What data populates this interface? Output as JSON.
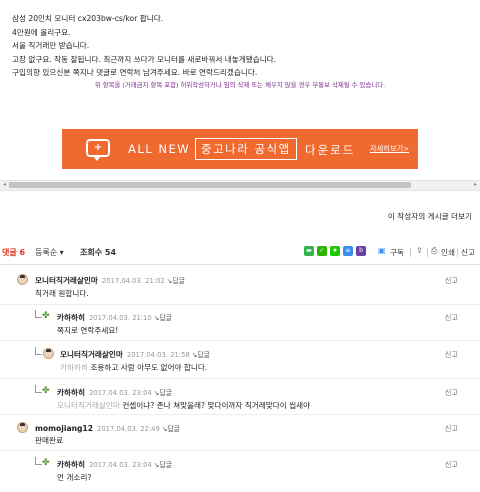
{
  "post": {
    "lines": [
      "삼성 20인치 모니터 cx203bw-cs/kor 팝니다.",
      "4만원에 올리구요.",
      "서울 직거래만 받습니다.",
      "고장 없구요. 작동 잘됩니다. 최근까지 쓰다가 모니터를 새로바꿔서 내놓게됐습니다.",
      "구입의향 있으신분 쪽지나 댓글로 연락처 남겨주세요. 바로 연락드리겠습니다."
    ],
    "notice": "위 항목을 (거래금지 항목 포함) 허위작성하거나 임의 삭제 또는 채우지 않을 경우 무통보 삭제될 수 있습니다."
  },
  "banner": {
    "lead": "ALL NEW",
    "boxed": "중고나라 공식앱",
    "tail": "다운로드",
    "more": "자세히보기>"
  },
  "author_posts": "이 작성자의 게시글 더보기",
  "comment_bar": {
    "label": "댓글",
    "count": "6",
    "sort": "등록순",
    "views_label": "조회수",
    "views": "54",
    "subscribe": "구독",
    "print": "인쇄",
    "report": "신고",
    "share_colors": [
      "#31b44a",
      "#2db400",
      "#1ec800",
      "#3c8df0",
      "#6a3fa0"
    ]
  },
  "comments": [
    {
      "nick": "모니터직거래살인마",
      "date": "2017.04.03. 21:02",
      "reply": "답글",
      "text": "직거래 원합니다.",
      "mention": "",
      "report": "신고"
    },
    {
      "nick": "카하하히",
      "date": "2017.04.03. 21:10",
      "reply": "답글",
      "text": "쪽지로 연락주세요!",
      "mention": "",
      "report": "신고"
    },
    {
      "nick": "모니터직거래살인마",
      "date": "2017.04.03. 21:58",
      "reply": "답글",
      "text": "조용하고 사람 아무도 없어야 합니다.",
      "mention": "카하하히",
      "report": "신고"
    },
    {
      "nick": "카하하히",
      "date": "2017.04.03. 23:04",
      "reply": "답글",
      "text": "컨셉이냐? 존나 쳐맞을래? 맞다이까자 직거래맞다이 씹새야",
      "mention": "모니터직거래살인마",
      "report": "신고"
    },
    {
      "nick": "momojiang12",
      "date": "2017.04.03. 22:49",
      "reply": "답글",
      "text": "판매완료",
      "mention": "",
      "report": "신고"
    },
    {
      "nick": "카하하히",
      "date": "2017.04.03. 23:04",
      "reply": "답글",
      "text": "먼 개소리?",
      "mention": "",
      "report": "신고"
    }
  ]
}
